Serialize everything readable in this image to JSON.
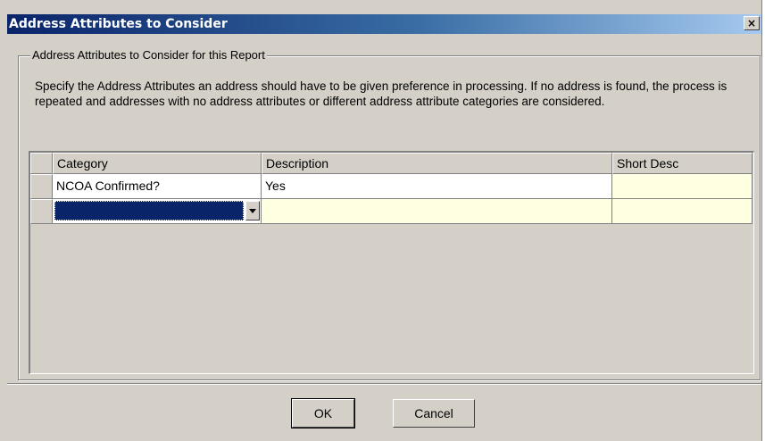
{
  "window": {
    "title": "Address Attributes to Consider",
    "close_glyph": "×"
  },
  "group": {
    "legend": "Address Attributes to Consider for this Report",
    "description": "Specify the Address Attributes an address should have to be given preference in processing.  If no address is found, the process is repeated and addresses with no address attributes or different address attribute categories are considered."
  },
  "grid": {
    "columns": [
      "Category",
      "Description",
      "Short Desc"
    ],
    "rows": [
      {
        "category": "NCOA Confirmed?",
        "description": "Yes",
        "short_desc": ""
      },
      {
        "category": "",
        "description": "",
        "short_desc": ""
      }
    ]
  },
  "buttons": {
    "ok": "OK",
    "cancel": "Cancel"
  },
  "icons": {
    "dropdown": "chevron-down-icon",
    "close": "close-icon"
  },
  "colors": {
    "title_start": "#0a246a",
    "title_end": "#a6caf0",
    "face": "#d4d0c8",
    "cream": "#ffffe1",
    "selection": "#0a246a"
  }
}
